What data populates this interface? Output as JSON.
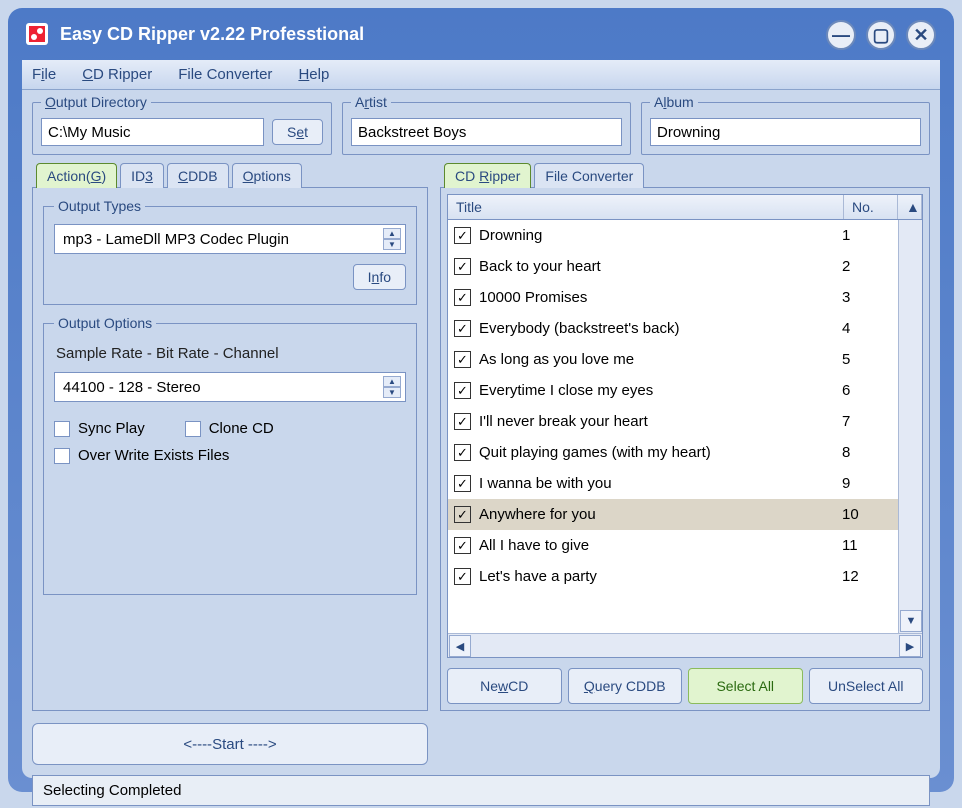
{
  "window": {
    "title": "Easy CD Ripper v2.22 Professtional"
  },
  "menu": {
    "file_pre": "F",
    "file_u": "i",
    "file_post": "le",
    "cd_u": "C",
    "cd_post": "D Ripper",
    "conv": "File Converter",
    "help_u": "H",
    "help_post": "elp"
  },
  "outdir": {
    "legend_u": "O",
    "legend_post": "utput Directory",
    "value": "C:\\My Music",
    "set_label_pre": "S",
    "set_label_u": "e",
    "set_label_post": "t"
  },
  "artist": {
    "legend_pre": "A",
    "legend_u": "r",
    "legend_post": "tist",
    "value": "Backstreet Boys"
  },
  "album": {
    "legend_pre": "A",
    "legend_u": "l",
    "legend_post": "bum",
    "value": "Drowning"
  },
  "leftTabs": {
    "action_pre": "Action(",
    "action_u": "G",
    "action_post": ")",
    "id3_pre": "ID",
    "id3_u": "3",
    "cddb_u": "C",
    "cddb_post": "DDB",
    "options_u": "O",
    "options_post": "ptions"
  },
  "outputTypes": {
    "legend_pre": "Output ",
    "legend_u": "T",
    "legend_post": "ypes",
    "value": "mp3 - LameDll MP3 Codec Plugin",
    "info_pre": "I",
    "info_u": "n",
    "info_post": "fo"
  },
  "outputOptions": {
    "legend": "Output Options",
    "label": "Sample Rate - Bit Rate - Channel",
    "value": "44100 - 128 - Stereo",
    "sync": "Sync Play",
    "clone": "Clone CD",
    "overwrite": "Over Write Exists Files"
  },
  "start": {
    "label": "<---- Start ---->",
    "pre": "<---- ",
    "u": "S",
    "post": "tart ---->"
  },
  "rightTabs": {
    "ripper_pre": "CD ",
    "ripper_u": "R",
    "ripper_post": "ipper",
    "conv": "File Converter"
  },
  "list": {
    "hdr_title": "Title",
    "hdr_no": "No.",
    "rows": [
      {
        "title": "Drowning",
        "no": "1",
        "checked": true
      },
      {
        "title": "Back to your heart",
        "no": "2",
        "checked": true
      },
      {
        "title": "10000 Promises",
        "no": "3",
        "checked": true
      },
      {
        "title": "Everybody (backstreet's back)",
        "no": "4",
        "checked": true
      },
      {
        "title": "As long as you love me",
        "no": "5",
        "checked": true
      },
      {
        "title": "Everytime I close my eyes",
        "no": "6",
        "checked": true
      },
      {
        "title": "I'll never break your heart",
        "no": "7",
        "checked": true
      },
      {
        "title": "Quit playing games (with my heart)",
        "no": "8",
        "checked": true
      },
      {
        "title": "I wanna be with you",
        "no": "9",
        "checked": true
      },
      {
        "title": "Anywhere for you",
        "no": "10",
        "checked": true,
        "selected": true
      },
      {
        "title": "All I have to give",
        "no": "11",
        "checked": true
      },
      {
        "title": "Let's have a party",
        "no": "12",
        "checked": true
      }
    ]
  },
  "buttons": {
    "newcd_pre": "Ne",
    "newcd_u": "w",
    "newcd_post": " CD",
    "query_u": "Q",
    "query_post": "uery CDDB",
    "selectall": "Select All",
    "unselect": "UnSelect All"
  },
  "status": "Selecting Completed",
  "glyphs": {
    "up": "▲",
    "down": "▼",
    "left": "◀",
    "right": "▶",
    "check": "✓",
    "minus": "—",
    "square": "▢",
    "x": "✕"
  }
}
